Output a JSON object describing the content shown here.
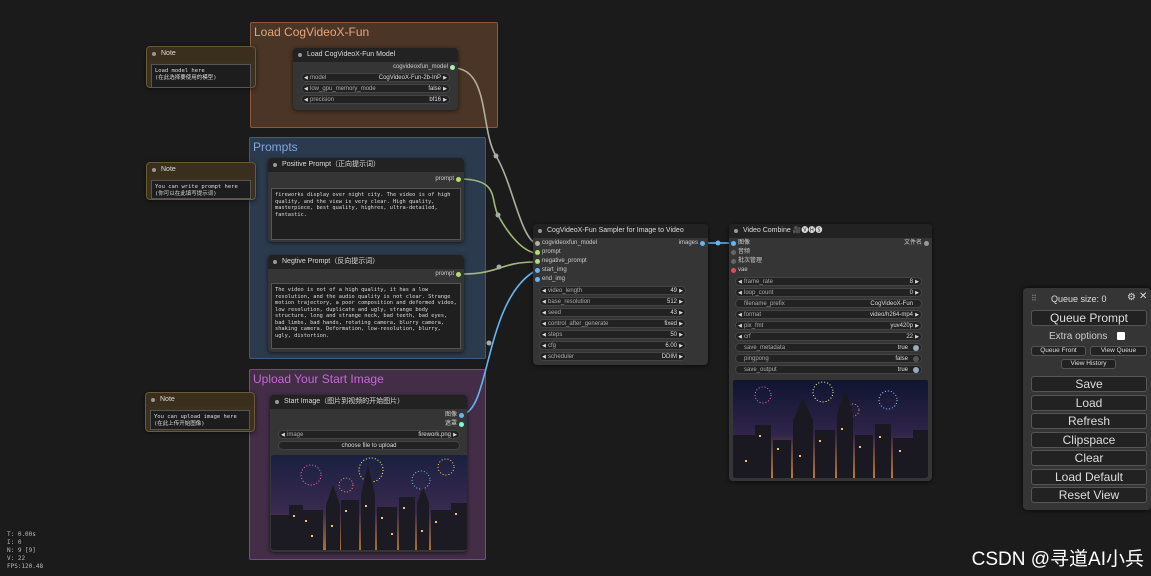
{
  "groups": {
    "load": "Load CogVideoX-Fun",
    "prompts": "Prompts",
    "upload": "Upload Your Start Image"
  },
  "notes": [
    {
      "title": "Note",
      "text": "Load model here\n(在此选择要使用的模型)"
    },
    {
      "title": "Note",
      "text": "You can write prompt here\n(你可以在此填写提示词)"
    },
    {
      "title": "Note",
      "text": "You can upload image here\n(在此上传开始图像)"
    }
  ],
  "load_model": {
    "title": "Load CogVideoX-Fun Model",
    "output": "cogvideoxfun_model",
    "widgets": [
      {
        "label": "model",
        "value": "CogVideoX-Fun-2b-InP"
      },
      {
        "label": "low_gpu_memory_mode",
        "value": "false"
      },
      {
        "label": "precision",
        "value": "bf16"
      }
    ]
  },
  "positive": {
    "title": "Positive Prompt（正向提示词）",
    "output": "prompt",
    "text": "fireworks display over night city. The video is of high quality, and the view is very clear. High quality, masterpiece, best quality, highres, ultra-detailed, fantastic."
  },
  "negative": {
    "title": "Negtive Prompt（反向提示词）",
    "output": "prompt",
    "text": "The video is not of a high quality, it has a low resolution, and the audio quality is not clear. Strange motion trajectory, a poor composition and deformed video, low resolution, duplicate and ugly, strange body structure, long and strange neck, bad teeth, bad eyes, bad limbs, bad hands, rotating camera, blurry camera, shaking camera. Deformation, low-resolution, blurry, ugly, distortion."
  },
  "start_image": {
    "title": "Start Image（图片到视频的开始图片）",
    "outputs": [
      "图像",
      "遮罩"
    ],
    "image_label": "image",
    "image_value": "firework.png",
    "upload_label": "choose file to upload"
  },
  "sampler": {
    "title": "CogVideoX-Fun Sampler for Image to Video",
    "inputs": [
      "cogvideoxfun_model",
      "prompt",
      "negative_prompt",
      "start_img",
      "end_img"
    ],
    "output": "images",
    "widgets": [
      {
        "label": "video_length",
        "value": "49"
      },
      {
        "label": "base_resolution",
        "value": "512"
      },
      {
        "label": "seed",
        "value": "43"
      },
      {
        "label": "control_after_generate",
        "value": "fixed"
      },
      {
        "label": "steps",
        "value": "50"
      },
      {
        "label": "cfg",
        "value": "6.00"
      },
      {
        "label": "scheduler",
        "value": "DDIM"
      }
    ]
  },
  "video_combine": {
    "title": "Video Combine 🎥🅥🅗🅢",
    "inputs": [
      "图像",
      "音频",
      "批次管理",
      "vae"
    ],
    "output": "文件名",
    "widgets": [
      {
        "label": "frame_rate",
        "value": "8",
        "kind": "arrow"
      },
      {
        "label": "loop_count",
        "value": "0",
        "kind": "arrow"
      },
      {
        "label": "filename_prefix",
        "value": "CogVideoX-Fun",
        "kind": "plain"
      },
      {
        "label": "format",
        "value": "video/h264-mp4",
        "kind": "arrow"
      },
      {
        "label": "pix_fmt",
        "value": "yuv420p",
        "kind": "arrow"
      },
      {
        "label": "crf",
        "value": "22",
        "kind": "arrow"
      },
      {
        "label": "save_metadata",
        "value": "true",
        "kind": "toggle_on"
      },
      {
        "label": "pingpong",
        "value": "false",
        "kind": "toggle_off"
      },
      {
        "label": "save_output",
        "value": "true",
        "kind": "toggle_on"
      }
    ]
  },
  "queue_panel": {
    "queue_size": "Queue size: 0",
    "queue_prompt": "Queue Prompt",
    "extra_options": "Extra options",
    "queue_front": "Queue Front",
    "view_queue": "View Queue",
    "view_history": "View History",
    "buttons": [
      "Save",
      "Load",
      "Refresh",
      "Clipspace",
      "Clear",
      "Load Default",
      "Reset View"
    ]
  },
  "stats": [
    "T: 0.00s",
    "I: 0",
    "N: 9 [9]",
    "V: 22",
    "FPS:120.48"
  ],
  "watermark": "CSDN @寻道AI小兵",
  "colors": {
    "model_link": "#b0b0a0",
    "prompt_link": "#9fb87a",
    "image_link": "#64b5f6"
  }
}
